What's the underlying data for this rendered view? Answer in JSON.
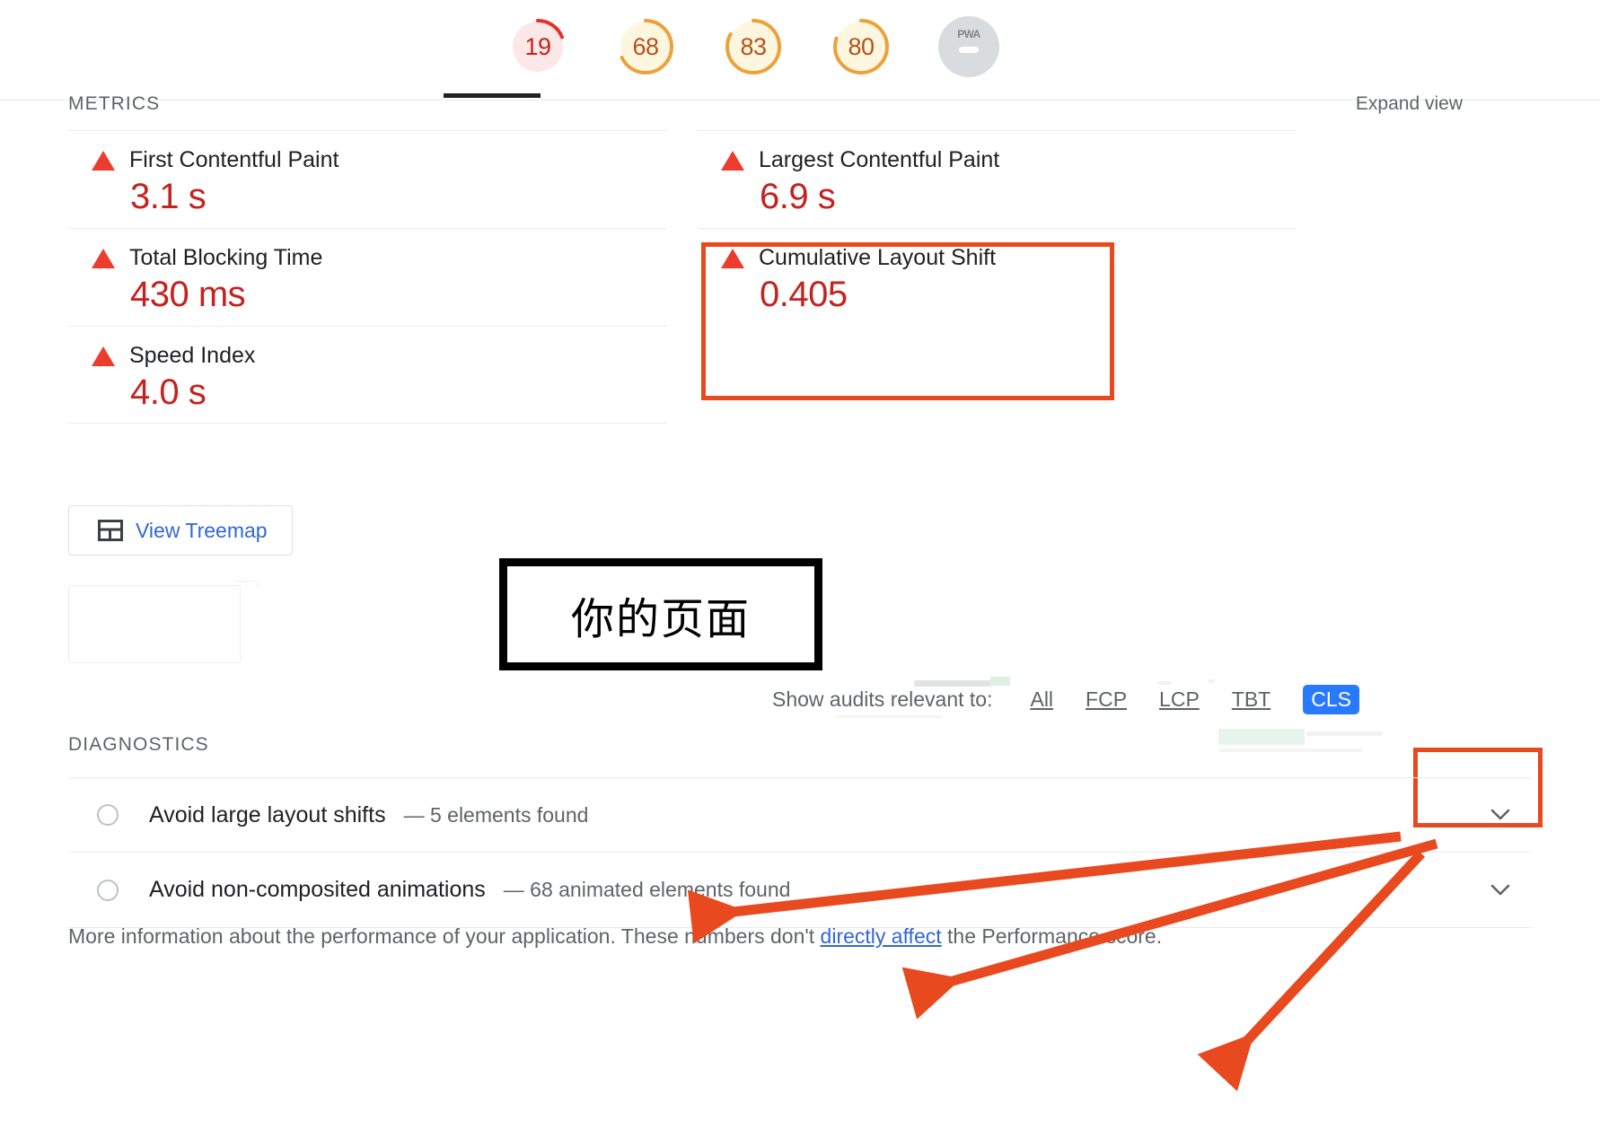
{
  "header": {
    "gauges": [
      {
        "name": "performance",
        "score": "19",
        "arc_pct": 19,
        "state": "fail",
        "selected": true
      },
      {
        "name": "accessibility",
        "score": "68",
        "arc_pct": 68,
        "state": "average",
        "selected": false
      },
      {
        "name": "best-practices",
        "score": "83",
        "arc_pct": 83,
        "state": "average",
        "selected": false
      },
      {
        "name": "seo",
        "score": "80",
        "arc_pct": 80,
        "state": "average",
        "selected": false
      },
      {
        "name": "pwa",
        "score": "PWA",
        "dash": "—",
        "state": "null",
        "selected": false
      }
    ]
  },
  "metrics": {
    "section_label": "METRICS",
    "expand_view_label": "Expand view",
    "left_column": [
      {
        "title": "First Contentful Paint",
        "value": "3.1 s",
        "state": "fail"
      },
      {
        "title": "Total Blocking Time",
        "value": "430 ms",
        "state": "fail"
      },
      {
        "title": "Speed Index",
        "value": "4.0 s",
        "state": "fail"
      }
    ],
    "right_column": [
      {
        "title": "Largest Contentful Paint",
        "value": "6.9 s",
        "state": "fail"
      },
      {
        "title": "Cumulative Layout Shift",
        "value": "0.405",
        "state": "fail",
        "highlighted": true
      }
    ]
  },
  "treemap": {
    "label": "View Treemap",
    "icon": "treemap-icon"
  },
  "annotation": {
    "callout_text": "你的页面"
  },
  "filters": {
    "label": "Show audits relevant to:",
    "options": [
      {
        "label": "All",
        "selected": false
      },
      {
        "label": "FCP",
        "selected": false
      },
      {
        "label": "LCP",
        "selected": false
      },
      {
        "label": "TBT",
        "selected": false
      },
      {
        "label": "CLS",
        "selected": true
      }
    ]
  },
  "diagnostics": {
    "section_label": "DIAGNOSTICS",
    "items": [
      {
        "title": "Avoid large layout shifts",
        "detail": "— 5 elements found"
      },
      {
        "title": "Avoid non-composited animations",
        "detail": "— 68 animated elements found"
      }
    ],
    "footer_pre": "More information about the performance of your application. These numbers don't ",
    "footer_link": "directly affect",
    "footer_post": " the Performance score."
  },
  "colors": {
    "fail_red": "#c5221f",
    "triangle_red": "#ec3c2d",
    "average_orange": "#ffa400",
    "link_blue": "#3367d6",
    "chip_blue": "#2979ff",
    "annotation_orange": "#e8491f",
    "muted_gray": "#5f6368"
  }
}
